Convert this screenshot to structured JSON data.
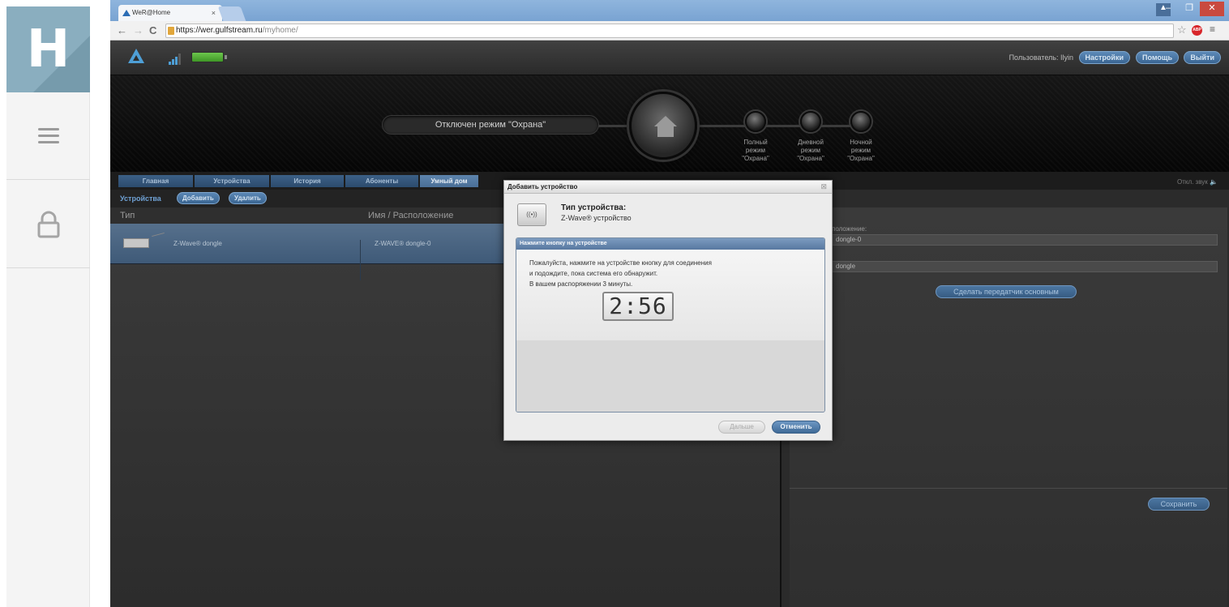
{
  "sidebar": {
    "logo_letter": "H"
  },
  "browser": {
    "tab_title": "WeR@Home",
    "tab_close": "×",
    "url_host": "https://wer.gulfstream.ru",
    "url_path": "/myhome/"
  },
  "header": {
    "user_label": "Пользователь: Ilyin",
    "settings_label": "Настройки",
    "help_label": "Помощь",
    "logout_label": "Выйти"
  },
  "status": {
    "mode_text": "Отключен режим \"Охрана\"",
    "modes": [
      {
        "line1": "Полный",
        "line2": "режим",
        "line3": "\"Охрана\""
      },
      {
        "line1": "Дневной",
        "line2": "режим",
        "line3": "\"Охрана\""
      },
      {
        "line1": "Ночной",
        "line2": "режим",
        "line3": "\"Охрана\""
      }
    ]
  },
  "nav": {
    "tabs": [
      "Главная",
      "Устройства",
      "История",
      "Абоненты",
      "Умный дом"
    ],
    "sound_label": "Откл. звук"
  },
  "subnav": {
    "title": "Устройства",
    "add_label": "Добавить",
    "delete_label": "Удалить"
  },
  "table": {
    "headers": [
      "Тип",
      "Имя / Расположение"
    ],
    "rows": [
      {
        "type": "Z-Wave® dongle",
        "name": "Z-WAVE® dongle-0"
      }
    ]
  },
  "right_panel": {
    "location_label": "положение:",
    "location_value": "dongle-0",
    "field2_value": "dongle",
    "set_main_label": "Сделать передатчик основным",
    "save_label": "Сохранить"
  },
  "modal": {
    "title": "Добавить устройство",
    "close": "⊠",
    "device_type_label": "Тип устройства:",
    "device_type_value": "Z-Wave® устройство",
    "panel_header": "Нажмите кнопку на устройстве",
    "instructions": [
      "Пожалуйста, нажмите на устройстве кнопку для соединения",
      "и подождите, пока система его обнаружит.",
      "В вашем распоряжении 3 минуты."
    ],
    "timer": "2:56",
    "next_label": "Дальше",
    "cancel_label": "Отменить"
  }
}
